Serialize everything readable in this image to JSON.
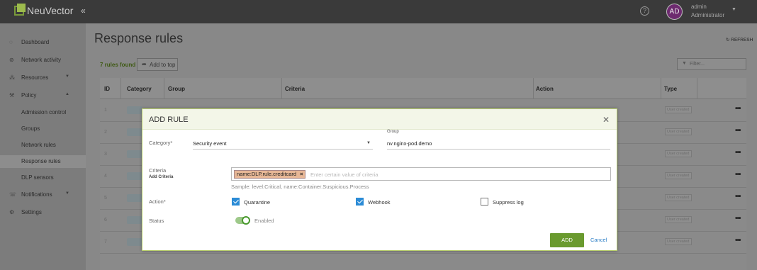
{
  "header": {
    "brand": "NeuVector",
    "collapse_glyph": "«",
    "help_glyph": "?",
    "avatar_initials": "AD",
    "user_name": "admin",
    "user_role": "Administrator"
  },
  "sidebar": {
    "items": [
      {
        "label": "Dashboard",
        "icon": "dashboard-icon",
        "glyph": "◌"
      },
      {
        "label": "Network activity",
        "icon": "network-icon",
        "glyph": "⊚"
      },
      {
        "label": "Resources",
        "icon": "resources-icon",
        "glyph": "⁂"
      },
      {
        "label": "Policy",
        "icon": "policy-icon",
        "glyph": "⚒"
      },
      {
        "label": "Notifications",
        "icon": "notifications-icon",
        "glyph": "☏"
      },
      {
        "label": "Settings",
        "icon": "settings-icon",
        "glyph": "⚙"
      }
    ],
    "policy_sub": [
      "Admission control",
      "Groups",
      "Network rules",
      "Response rules",
      "DLP sensors"
    ]
  },
  "main": {
    "title": "Response rules",
    "refresh": "REFRESH",
    "found": "7 rules found",
    "add_to_top": "Add to top",
    "filter_placeholder": "Filter...",
    "columns": [
      "ID",
      "Category",
      "Group",
      "Criteria",
      "Action",
      "Type"
    ],
    "rows": [
      {
        "id": "1",
        "type": "User created"
      },
      {
        "id": "2",
        "type": "User created"
      },
      {
        "id": "3",
        "type": "User created"
      },
      {
        "id": "4",
        "type": "User created"
      },
      {
        "id": "5",
        "type": "User created"
      },
      {
        "id": "6",
        "type": "User created"
      },
      {
        "id": "7",
        "type": "User created"
      }
    ],
    "row_menu": "•••"
  },
  "modal": {
    "title": "ADD RULE",
    "category_label": "Category*",
    "category_value": "Security event",
    "group_label": "Group",
    "group_value": "nv.nginx-pod.demo",
    "criteria_label": "Criteria",
    "add_criteria": "Add Criteria",
    "criteria_tag": "name:DLP.rule.creditcard",
    "criteria_placeholder": "Enter certain value of criteria",
    "sample": "Sample: level:Critical, name:Container.Suspicious.Process",
    "action_label": "Action*",
    "actions": [
      {
        "label": "Quarantine",
        "checked": true
      },
      {
        "label": "Webhook",
        "checked": true
      },
      {
        "label": "Suppress log",
        "checked": false
      }
    ],
    "status_label": "Status",
    "status_value": "Enabled",
    "add_button": "ADD",
    "cancel_button": "Cancel"
  }
}
